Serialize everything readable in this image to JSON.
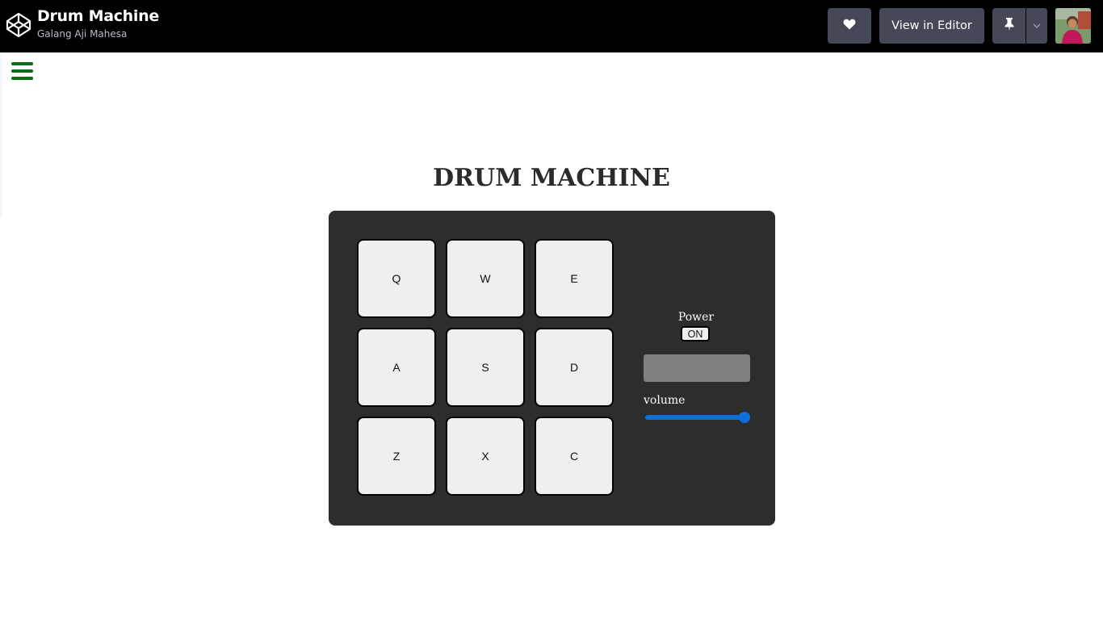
{
  "header": {
    "title": "Drum Machine",
    "author": "Galang Aji Mahesa",
    "view_in_editor_label": "View in Editor",
    "logo_icon": "codepen-logo-icon",
    "heart_icon": "heart-icon",
    "pin_icon": "pin-icon",
    "dropdown_icon": "chevron-down-icon"
  },
  "menu": {
    "icon": "hamburger-icon",
    "color": "#0b6b14"
  },
  "main": {
    "heading": "DRUM MACHINE",
    "pads": [
      "Q",
      "W",
      "E",
      "A",
      "S",
      "D",
      "Z",
      "X",
      "C"
    ],
    "power_label": "Power",
    "power_button": "ON",
    "display_text": "",
    "volume_label": "volume",
    "volume_level": 1.0
  },
  "colors": {
    "topbar": "#000000",
    "button": "#444857",
    "machine": "#2d2d2d",
    "pad": "#efefef",
    "display": "#808080",
    "slider": "#0f6fd9"
  }
}
